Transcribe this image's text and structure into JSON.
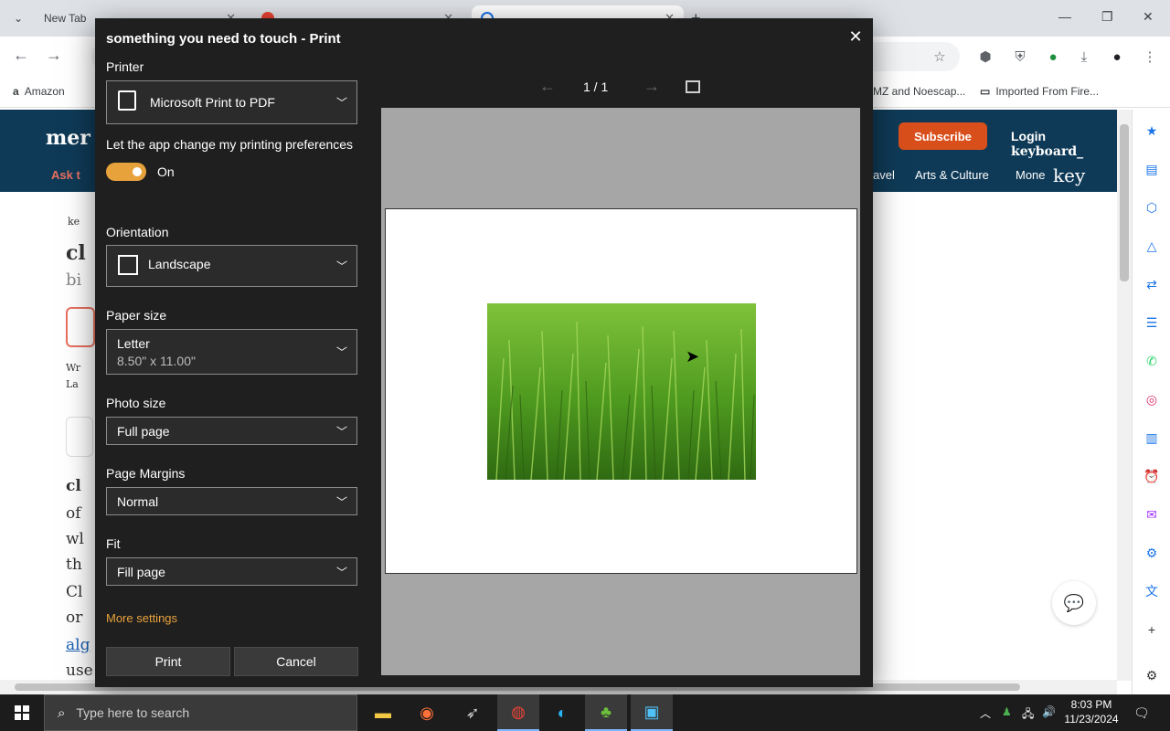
{
  "browser": {
    "tabs": [
      {
        "title": "New Tab"
      },
      {
        "title": ""
      },
      {
        "title": ""
      }
    ],
    "bookmarks": [
      {
        "label": "Amazon"
      },
      {
        "label": "MZ and Noescap..."
      },
      {
        "label": "Imported From Fire..."
      }
    ]
  },
  "site": {
    "logo_fragment": "mer",
    "ask_fragment": "Ask t",
    "subscribe_label": "Subscribe",
    "login_label": "Login",
    "keyword_label": "keyboard_",
    "nav": [
      "avel",
      "Arts & Culture",
      "Mone",
      "key"
    ],
    "article_fragments": [
      "ke",
      "cl",
      "bi",
      "Wr",
      "La",
      "cl",
      "of",
      "wl",
      "th",
      "Cl",
      "or",
      "alg",
      "use"
    ]
  },
  "print_dialog": {
    "title": "something you need to touch - Print",
    "printer_label": "Printer",
    "printer_value": "Microsoft Print to PDF",
    "app_pref_label": "Let the app change my printing preferences",
    "app_pref_state": "On",
    "orientation_label": "Orientation",
    "orientation_value": "Landscape",
    "paper_size_label": "Paper size",
    "paper_size_value": "Letter",
    "paper_size_detail": "8.50\" x 11.00\"",
    "photo_size_label": "Photo size",
    "photo_size_value": "Full page",
    "margins_label": "Page Margins",
    "margins_value": "Normal",
    "fit_label": "Fit",
    "fit_value": "Fill page",
    "more_settings": "More settings",
    "print_button": "Print",
    "cancel_button": "Cancel",
    "page_indicator": "1  /  1"
  },
  "taskbar": {
    "search_placeholder": "Type here to search",
    "time": "8:03 PM",
    "date": "11/23/2024"
  },
  "colors": {
    "dialog_bg": "#1f1f1f",
    "accent": "#e8a23b",
    "site_header": "#0f3a57",
    "subscribe": "#d94f1c"
  }
}
